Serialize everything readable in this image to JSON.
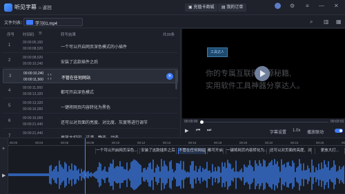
{
  "app": {
    "title": "听见字幕",
    "home": "返回",
    "vip_btn": "充值卡商城",
    "orders_btn": "我的订单"
  },
  "file": {
    "label": "文件列表：",
    "name": "学习01.mp4"
  },
  "list": {
    "h_num": "序号",
    "h_time": "时间码",
    "h_text": "转写结果",
    "h_count": "共39条",
    "rows": [
      {
        "n": "1",
        "t1": "00:00:05,160",
        "t2": "00:00:08,520",
        "text": "一个可以开启网页深色模式的小插件"
      },
      {
        "n": "2",
        "t1": "00:00:08,520",
        "t2": "00:00:10,240",
        "text": "安装了这款插件之后"
      },
      {
        "n": "3",
        "t1": "00:00:10,240",
        "t2": "00:00:11,560",
        "text": "不管在任何网站"
      },
      {
        "n": "4",
        "t1": "00:00:11,560",
        "t2": "00:00:13,320",
        "text": "都可开启深色模式"
      },
      {
        "n": "5",
        "t1": "00:00:13,320",
        "t2": "00:00:16,000",
        "text": "一键将网页内容转化为黑色"
      },
      {
        "n": "6",
        "t1": "00:00:16,000",
        "t2": "00:00:21,440",
        "text": "还可以对页面的亮度、对比度、灰度等进行调节"
      },
      {
        "n": "7",
        "t1": "00:00:21,440",
        "t2": "00:00:24,600",
        "text": "更放大打印、过滤，静态、动态"
      }
    ]
  },
  "video": {
    "watermark": "工具达人",
    "line1": "你的专属互联网资源秘籍,",
    "line2": "实用软件工具神器分享达人。"
  },
  "controls": {
    "cur": "00:00:00",
    "total": "00:02:01",
    "subtitle_settings": "字幕设置",
    "speed": "1.0x",
    "follow": "播放联动"
  },
  "timeline": {
    "ticks": [
      "00:00",
      "00:04",
      "00:06",
      "00:08",
      "00:10",
      "00:12",
      "00:14",
      "00:16",
      "00:18",
      "00:20",
      "00:22",
      "00:24",
      "00:26",
      "00:28"
    ],
    "segments": [
      "一个可以开启网页深色...",
      "安装了这款插件之后",
      "不管在任何网站",
      "都可开启深色模...",
      "一键将网页内容转化为...",
      "还可以对页面的亮度、对...",
      "更放大打..."
    ]
  },
  "colors": {
    "accent": "#3d7bff",
    "wave": "#3a7be8"
  }
}
